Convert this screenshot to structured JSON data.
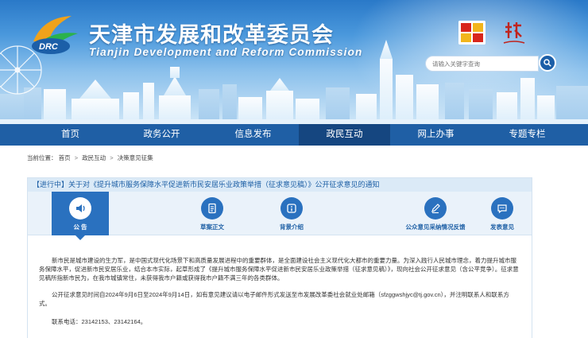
{
  "header": {
    "logo_text": "DRC",
    "title": "天津市发展和改革委员会",
    "subtitle": "Tianjin Development and Reform Commission",
    "search": {
      "placeholder": "请输入关键字查询"
    }
  },
  "nav": {
    "items": [
      {
        "label": "首页",
        "active": false
      },
      {
        "label": "政务公开",
        "active": false
      },
      {
        "label": "信息发布",
        "active": false
      },
      {
        "label": "政民互动",
        "active": true
      },
      {
        "label": "网上办事",
        "active": false
      },
      {
        "label": "专题专栏",
        "active": false
      }
    ]
  },
  "breadcrumb": {
    "prefix": "当前位置：",
    "items": [
      "首页",
      "政民互动",
      "决策意见征集"
    ],
    "separator": ">"
  },
  "notice": {
    "status": "【进行中】",
    "title": "关于对《提升城市服务保障水平促进新市民安居乐业政策举措（征求意见稿）》公开征求意见的通知"
  },
  "tabs": [
    {
      "label": "公 告",
      "icon": "speaker-icon",
      "active": true
    },
    {
      "label": "草案正文",
      "icon": "document-icon",
      "active": false
    },
    {
      "label": "背景介绍",
      "icon": "info-icon",
      "active": false
    },
    {
      "label": "公众意见采纳情况反馈",
      "icon": "pen-icon",
      "active": false
    },
    {
      "label": "发表意见",
      "icon": "chat-icon",
      "active": false
    }
  ],
  "content": {
    "paragraph1": "新市民是城市建设的生力军，是中国式现代化场景下和高质量发展进程中的重要群体，是全面建设社会主义现代化大都市的重要力量。为深入践行人民城市理念，着力提升城市服务保障水平，促进新市民安居乐业，结合本市实际，起草形成了《提升城市服务保障水平促进新市民安居乐业政策举措（征求意见稿）》，现向社会公开征求意见（含公平竞争）。征求意见稿所指新市民为，在我市城镇常住，未获得我市户籍或获得我市户籍不满三年的各类群体。",
    "paragraph2": "公开征求意见时间自2024年9月6日至2024年9月14日，如有意见建议请以电子邮件形式发送至市发展改革委社会就业处邮箱（sfzggwshjyc@tj.gov.cn），并注明联系人和联系方式。",
    "paragraph3": "联系电话：23142153、23142164。"
  },
  "colors": {
    "nav_bg": "#1f5fa5",
    "nav_active": "#154680",
    "accent": "#2a71bf",
    "notice_bg": "#dbeaf7",
    "tabs_bg": "#eaf2fa"
  }
}
